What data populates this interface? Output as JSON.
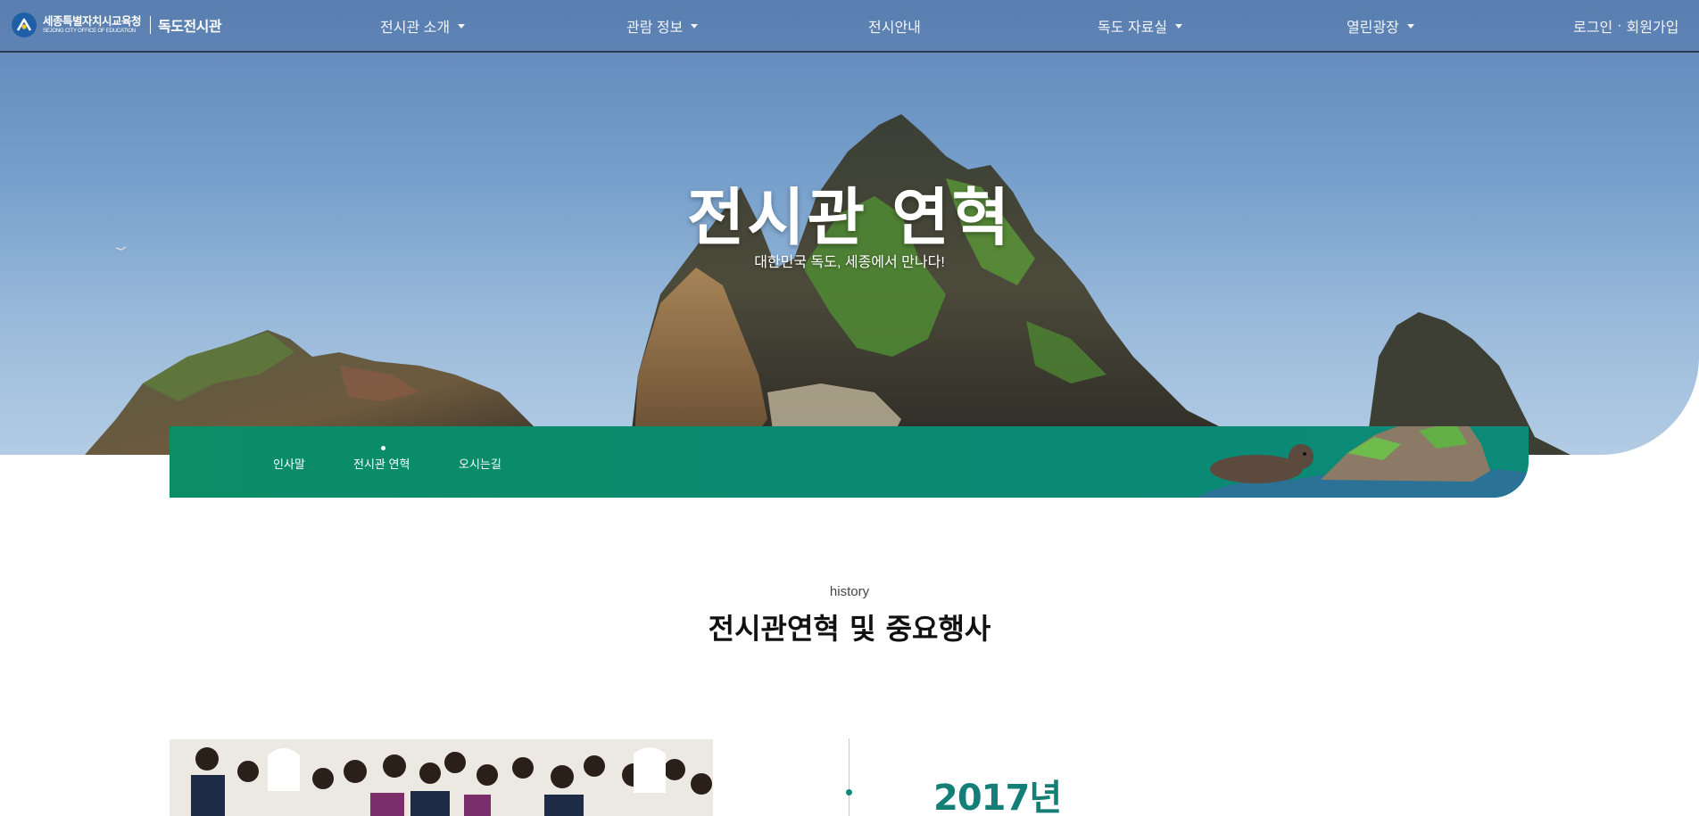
{
  "logo": {
    "org_ko": "세종특별자치시교육청",
    "org_en": "SEJONG CITY OFFICE OF EDUCATION",
    "site_name": "독도전시관"
  },
  "nav": {
    "items": [
      {
        "label": "전시관 소개",
        "has_dropdown": true
      },
      {
        "label": "관람 정보",
        "has_dropdown": true
      },
      {
        "label": "전시안내",
        "has_dropdown": false
      },
      {
        "label": "독도 자료실",
        "has_dropdown": true
      },
      {
        "label": "열린광장",
        "has_dropdown": true
      }
    ],
    "login": "로그인",
    "separator": "·",
    "signup": "회원가입"
  },
  "hero": {
    "title": "전시관 연혁",
    "subtitle": "대한민국 독도, 세종에서 만나다!"
  },
  "subnav": {
    "items": [
      {
        "label": "인사말",
        "active": false
      },
      {
        "label": "전시관 연혁",
        "active": true
      },
      {
        "label": "오시는길",
        "active": false
      }
    ]
  },
  "section": {
    "eyebrow": "history",
    "title": "전시관연혁 및 중요행사"
  },
  "timeline": {
    "entries": [
      {
        "year": "2017년"
      }
    ]
  },
  "colors": {
    "accent_green": "#0b8d66",
    "year_teal": "#137f76",
    "nav_text": "#f2f5fa"
  },
  "icons": [
    "sejong-logo-icon",
    "dropdown-caret-icon",
    "active-dot-icon",
    "timeline-dot-icon"
  ]
}
